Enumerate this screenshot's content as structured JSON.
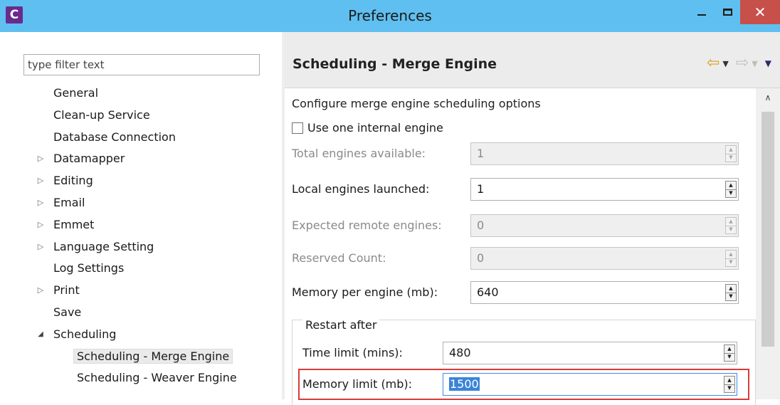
{
  "window": {
    "app_icon_letter": "C",
    "title": "Preferences",
    "minimize": "minimize",
    "maximize": "maximize",
    "close_glyph": "✕"
  },
  "filter": {
    "placeholder": "type filter text",
    "value": ""
  },
  "tree": {
    "items": [
      {
        "label": "General",
        "expandable": false,
        "expanded": false,
        "level": 0
      },
      {
        "label": "Clean-up Service",
        "expandable": false,
        "expanded": false,
        "level": 0
      },
      {
        "label": "Database Connection",
        "expandable": false,
        "expanded": false,
        "level": 0
      },
      {
        "label": "Datamapper",
        "expandable": true,
        "expanded": false,
        "level": 0
      },
      {
        "label": "Editing",
        "expandable": true,
        "expanded": false,
        "level": 0
      },
      {
        "label": "Email",
        "expandable": true,
        "expanded": false,
        "level": 0
      },
      {
        "label": "Emmet",
        "expandable": true,
        "expanded": false,
        "level": 0
      },
      {
        "label": "Language Setting",
        "expandable": true,
        "expanded": false,
        "level": 0
      },
      {
        "label": "Log Settings",
        "expandable": false,
        "expanded": false,
        "level": 0
      },
      {
        "label": "Print",
        "expandable": true,
        "expanded": false,
        "level": 0
      },
      {
        "label": "Save",
        "expandable": false,
        "expanded": false,
        "level": 0
      },
      {
        "label": "Scheduling",
        "expandable": true,
        "expanded": true,
        "level": 0
      },
      {
        "label": "Scheduling - Merge Engine",
        "expandable": false,
        "expanded": false,
        "level": 1,
        "selected": true
      },
      {
        "label": "Scheduling - Weaver Engine",
        "expandable": false,
        "expanded": false,
        "level": 1
      }
    ]
  },
  "page": {
    "title": "Scheduling - Merge Engine",
    "description": "Configure merge engine scheduling options",
    "use_one_internal_engine": {
      "label": "Use one internal engine",
      "checked": false
    },
    "fields": [
      {
        "id": "total",
        "label": "Total engines available:",
        "value": "1",
        "enabled": false
      },
      {
        "id": "local",
        "label": "Local engines launched:",
        "value": "1",
        "enabled": true
      },
      {
        "id": "remote",
        "label": "Expected remote engines:",
        "value": "0",
        "enabled": false
      },
      {
        "id": "reserved",
        "label": "Reserved Count:",
        "value": "0",
        "enabled": false
      },
      {
        "id": "memory",
        "label": "Memory per engine (mb):",
        "value": "640",
        "enabled": true
      }
    ],
    "restart_group": {
      "legend": "Restart after",
      "time_limit": {
        "label": "Time limit (mins):",
        "value": "480"
      },
      "memory_limit": {
        "label": "Memory limit (mb):",
        "value": "1500"
      }
    }
  },
  "icons": {
    "back": "back-arrow-icon",
    "forward": "forward-arrow-icon",
    "view_menu": "view-menu-icon",
    "collapsed": "tree-collapsed-icon",
    "expanded": "tree-expanded-icon"
  },
  "colors": {
    "titlebar": "#5fbff0",
    "close": "#c7504b",
    "highlight_box": "#d93a3a",
    "selection": "#3a84d8"
  }
}
